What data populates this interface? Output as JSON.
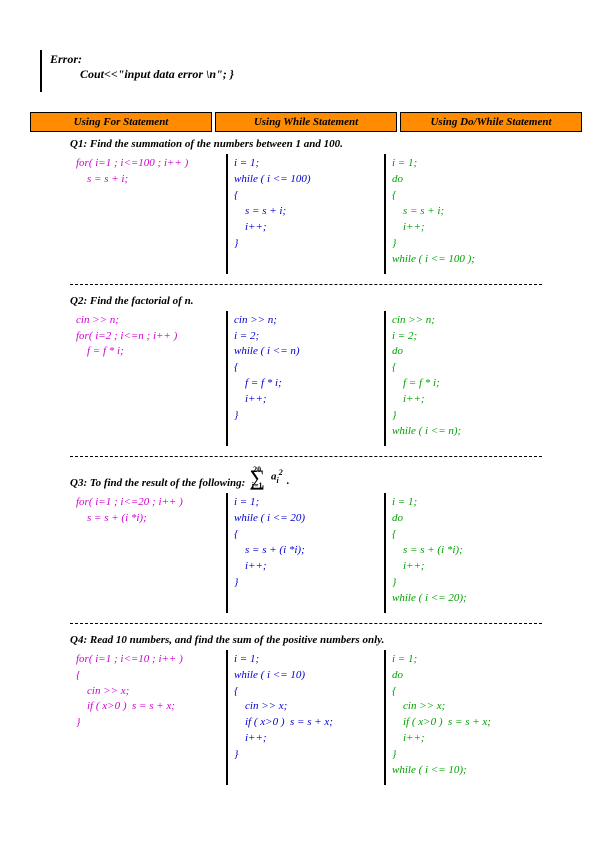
{
  "error": {
    "title": "Error:",
    "code": "Cout<<\"input data error \\n\"; }"
  },
  "headers": {
    "h1": "Using For Statement",
    "h2": "Using While Statement",
    "h3": "Using Do/While Statement"
  },
  "q1": {
    "text": "Q1: Find the summation of the numbers between 1 and 100.",
    "for_code": "for( i=1 ; i<=100 ; i++ )\n    s = s + i;",
    "while_code": "i = 1;\nwhile ( i <= 100)\n{\n    s = s + i;\n    i++;\n}",
    "do_code": "i = 1;\ndo\n{\n    s = s + i;\n    i++;\n}\nwhile ( i <= 100 );"
  },
  "q2": {
    "text": "Q2: Find the factorial of n.",
    "for_code": "cin >> n;\nfor( i=2 ; i<=n ; i++ )\n    f = f * i;",
    "while_code": "cin >> n;\ni = 2;\nwhile ( i <= n)\n{\n    f = f * i;\n    i++;\n}",
    "do_code": "cin >> n;\ni = 2;\ndo\n{\n    f = f * i;\n    i++;\n}\nwhile ( i <= n);"
  },
  "q3": {
    "text": "Q3: To find the result of the following: ",
    "sigma_top": "20",
    "sigma_bot": "i=1",
    "sigma_right": "a",
    "sigma_right_sub": "i",
    "sigma_right_sup": "2",
    "period": ".",
    "for_code": "for( i=1 ; i<=20 ; i++ )\n    s = s + (i *i);",
    "while_code": "i = 1;\nwhile ( i <= 20)\n{\n    s = s + (i *i);\n    i++;\n}",
    "do_code": "i = 1;\ndo\n{\n    s = s + (i *i);\n    i++;\n}\nwhile ( i <= 20);"
  },
  "q4": {
    "text": "Q4: Read 10 numbers, and find the sum of the positive numbers only.",
    "for_code": "for( i=1 ; i<=10 ; i++ )\n{\n    cin >> x;\n    if ( x>0 )  s = s + x;\n}",
    "while_code": "i = 1;\nwhile ( i <= 10)\n{\n    cin >> x;\n    if ( x>0 )  s = s + x;\n    i++;\n}",
    "do_code": "i = 1;\ndo\n{\n    cin >> x;\n    if ( x>0 )  s = s + x;\n    i++;\n}\nwhile ( i <= 10);"
  }
}
